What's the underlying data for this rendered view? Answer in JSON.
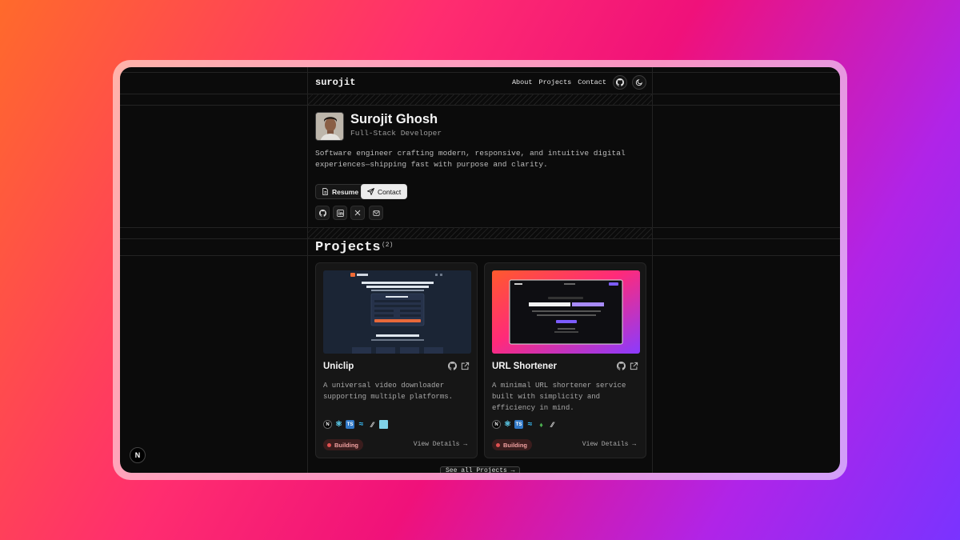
{
  "nav": {
    "brand": "surojit",
    "links": [
      "About",
      "Projects",
      "Contact"
    ]
  },
  "hero": {
    "name": "Surojit Ghosh",
    "role": "Full-Stack Developer",
    "bio": "Software engineer crafting modern, responsive, and intuitive digital experiences—shipping fast with purpose and clarity.",
    "resume_label": "Resume",
    "contact_label": "Contact"
  },
  "social": [
    "github-icon",
    "linkedin-icon",
    "x-icon",
    "mail-icon"
  ],
  "projects": {
    "title": "Projects",
    "count": "(2)",
    "items": [
      {
        "title": "Uniclip",
        "description": "A universal video downloader supporting multiple platforms.",
        "status": "Building",
        "details_label": "View Details →"
      },
      {
        "title": "URL Shortener",
        "description": "A minimal URL shortener service built with simplicity and efficiency in mind.",
        "status": "Building",
        "details_label": "View Details →"
      }
    ],
    "see_all": "See all Projects →"
  },
  "colors": {
    "background": "#0b0b0b",
    "card": "#161616",
    "status": "#e05050"
  }
}
